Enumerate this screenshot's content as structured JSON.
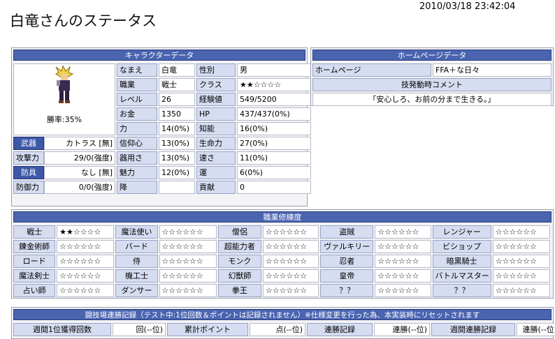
{
  "header": {
    "title": "白竜さんのステータス",
    "timestamp": "2010/03/18 23:42:04"
  },
  "character": {
    "heading": "キャラクターデータ",
    "win_rate": "勝率:35%",
    "rows": [
      [
        "なまえ",
        "白竜",
        "性別",
        "男"
      ],
      [
        "職業",
        "戦士",
        "クラス",
        "★★☆☆☆☆"
      ],
      [
        "レベル",
        "26",
        "経験値",
        "549/5200"
      ],
      [
        "お金",
        "1350",
        "HP",
        "437/437(0%)"
      ],
      [
        "力",
        "14(0%)",
        "知能",
        "16(0%)"
      ]
    ],
    "lower": [
      {
        "k": "武器",
        "v": "カトラス [無]",
        "k2": "信仰心",
        "v2": "13(0%)",
        "k3": "生命力",
        "v3": "27(0%)",
        "btn": true
      },
      {
        "k": "攻撃力",
        "v": "29/0(強度)",
        "k2": "器用さ",
        "v2": "13(0%)",
        "k3": "速さ",
        "v3": "11(0%)",
        "btn": false
      },
      {
        "k": "防具",
        "v": "なし [無]",
        "k2": "魅力",
        "v2": "12(0%)",
        "k3": "運",
        "v3": "6(0%)",
        "btn": true
      },
      {
        "k": "防御力",
        "v": "0/0(強度)",
        "k2": "降",
        "v2": "",
        "k3": "貢献",
        "v3": "0",
        "btn": false
      }
    ]
  },
  "homepage": {
    "heading": "ホームページデータ",
    "hp_label": "ホームページ",
    "hp_value": "FFA＋な日々",
    "comment_label": "技発動時コメント",
    "comment": "「安心しろ、お前の分まで生きる。」"
  },
  "jobs": {
    "heading": "職業修練度",
    "rows": [
      [
        [
          "戦士",
          "★★☆☆☆☆"
        ],
        [
          "魔法使い",
          "☆☆☆☆☆☆"
        ],
        [
          "僧侶",
          "☆☆☆☆☆☆"
        ],
        [
          "盗賊",
          "☆☆☆☆☆☆"
        ],
        [
          "レンジャー",
          "☆☆☆☆☆☆"
        ]
      ],
      [
        [
          "錬金術師",
          "☆☆☆☆☆☆"
        ],
        [
          "バード",
          "☆☆☆☆☆☆"
        ],
        [
          "超能力者",
          "☆☆☆☆☆☆"
        ],
        [
          "ヴァルキリー",
          "☆☆☆☆☆☆"
        ],
        [
          "ビショップ",
          "☆☆☆☆☆☆"
        ]
      ],
      [
        [
          "ロード",
          "☆☆☆☆☆☆"
        ],
        [
          "侍",
          "☆☆☆☆☆☆"
        ],
        [
          "モンク",
          "☆☆☆☆☆☆"
        ],
        [
          "忍者",
          "☆☆☆☆☆☆"
        ],
        [
          "暗黒騎士",
          "☆☆☆☆☆☆"
        ]
      ],
      [
        [
          "魔法剣士",
          "☆☆☆☆☆☆"
        ],
        [
          "機工士",
          "☆☆☆☆☆☆"
        ],
        [
          "幻獣師",
          "☆☆☆☆☆☆"
        ],
        [
          "皇帝",
          "☆☆☆☆☆☆"
        ],
        [
          "バトルマスター",
          "☆☆☆☆☆☆"
        ]
      ],
      [
        [
          "占い師",
          "☆☆☆☆☆☆"
        ],
        [
          "ダンサー",
          "☆☆☆☆☆☆"
        ],
        [
          "拳王",
          "☆☆☆☆☆☆"
        ],
        [
          "？？",
          "☆☆☆☆☆☆"
        ],
        [
          "？？",
          "☆☆☆☆☆☆"
        ]
      ]
    ]
  },
  "arena": {
    "heading": "闘技場連勝記録（テスト中:1位回数＆ポイントは記録されません）※仕様変更を行った為、本実装時にリセットされます",
    "cells": [
      [
        "週間1位獲得回数",
        "回(--位)"
      ],
      [
        "累計ポイント",
        "点(--位)"
      ],
      [
        "連勝記録",
        "連勝(--位)"
      ],
      [
        "週間連勝記録",
        "連勝(--位)"
      ]
    ]
  },
  "colors": {
    "header_bg": "#4a64b0",
    "label_bg": "#d6ddf1",
    "button_bg": "#3d58a8"
  }
}
